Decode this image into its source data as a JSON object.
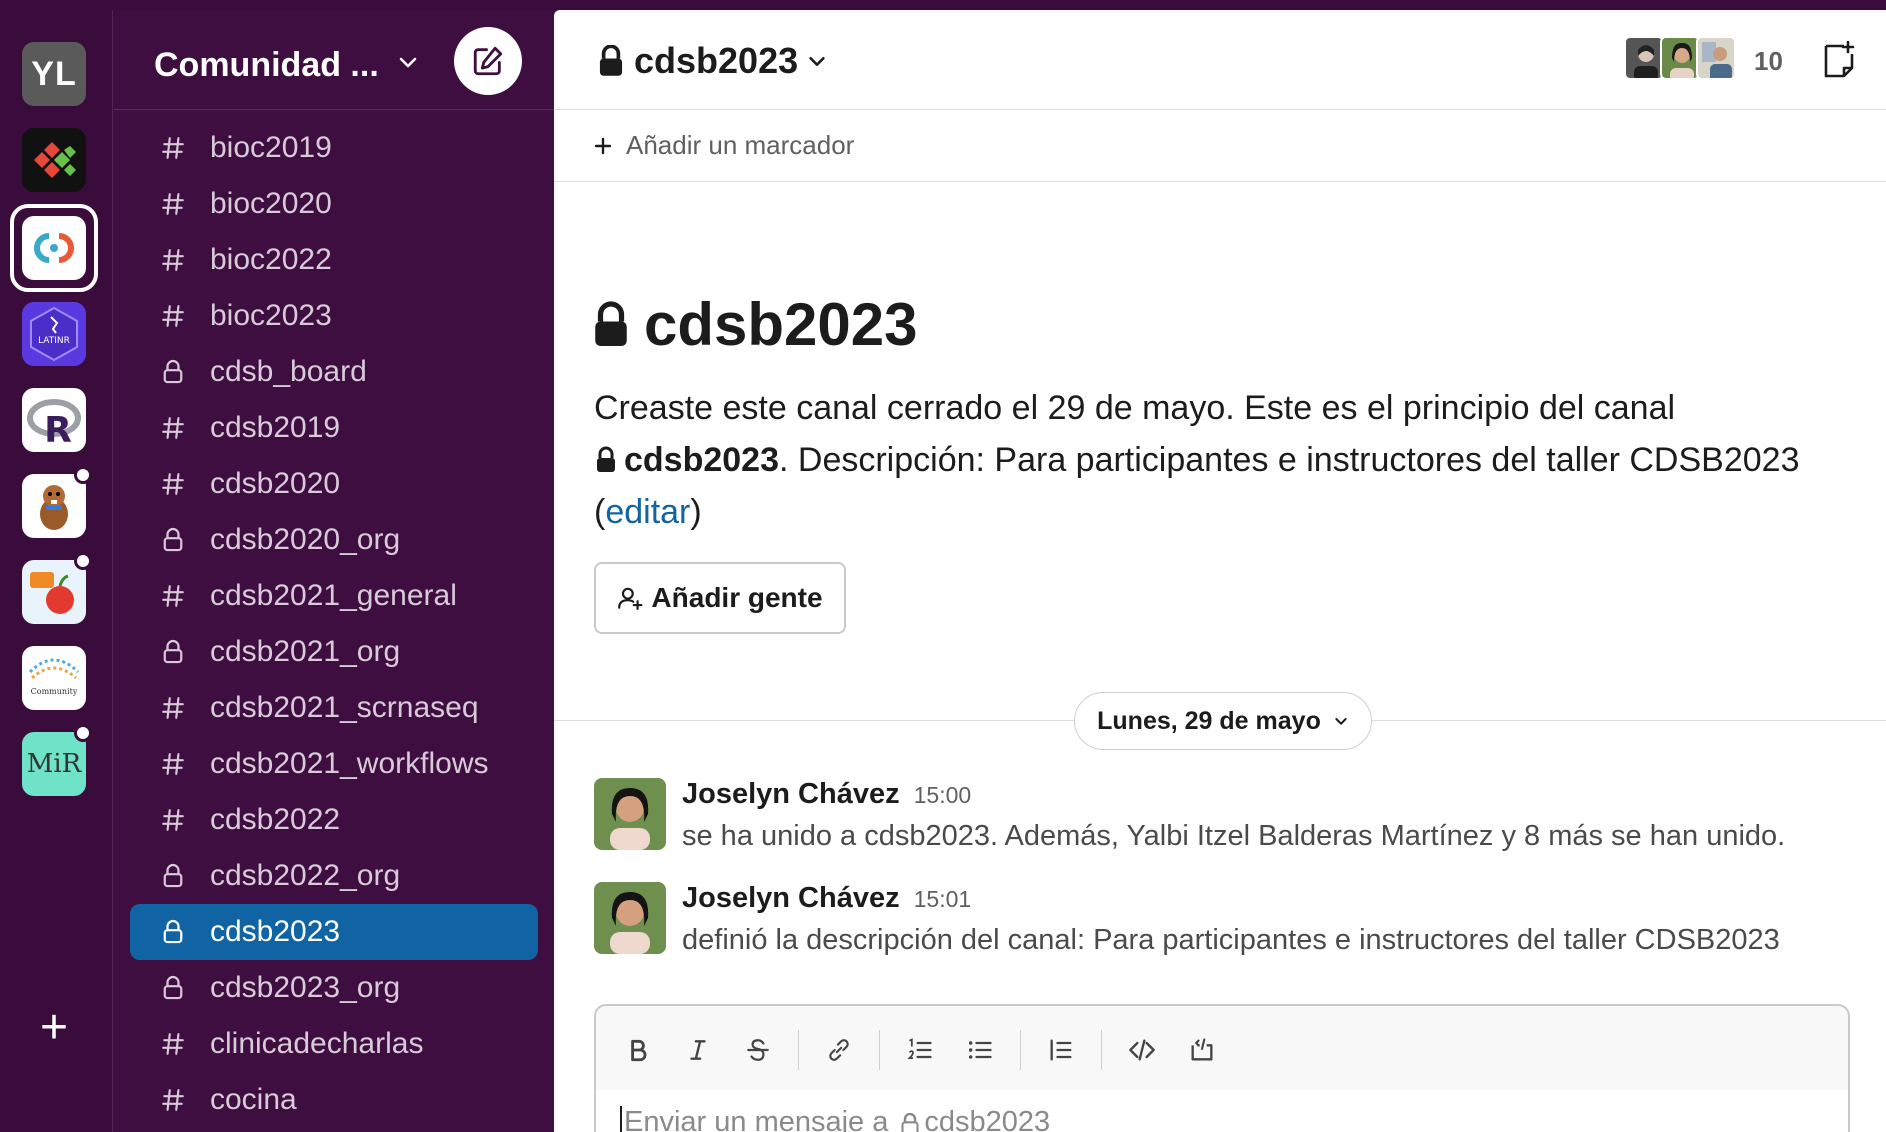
{
  "rail": {
    "workspaces": [
      {
        "initials": "YL",
        "name": "YL"
      },
      {
        "name": "Bioconductor"
      },
      {
        "name": "Comunidad de Desarrolladores de Software en Bioinformática"
      },
      {
        "name": "LatinR",
        "label": "LATINR"
      },
      {
        "name": "R workspace"
      },
      {
        "name": "rOpenSci"
      },
      {
        "name": "Apple community"
      },
      {
        "name": "Community",
        "label": "Community"
      },
      {
        "name": "MiR",
        "label": "MiR"
      }
    ],
    "add_label": "+"
  },
  "sidebar": {
    "workspace_name": "Comunidad ...",
    "channels": [
      {
        "name": "bioc2019",
        "type": "public"
      },
      {
        "name": "bioc2020",
        "type": "public"
      },
      {
        "name": "bioc2022",
        "type": "public"
      },
      {
        "name": "bioc2023",
        "type": "public"
      },
      {
        "name": "cdsb_board",
        "type": "private"
      },
      {
        "name": "cdsb2019",
        "type": "public"
      },
      {
        "name": "cdsb2020",
        "type": "public"
      },
      {
        "name": "cdsb2020_org",
        "type": "private"
      },
      {
        "name": "cdsb2021_general",
        "type": "public"
      },
      {
        "name": "cdsb2021_org",
        "type": "private"
      },
      {
        "name": "cdsb2021_scrnaseq",
        "type": "public"
      },
      {
        "name": "cdsb2021_workflows",
        "type": "public"
      },
      {
        "name": "cdsb2022",
        "type": "public"
      },
      {
        "name": "cdsb2022_org",
        "type": "private"
      },
      {
        "name": "cdsb2023",
        "type": "private",
        "active": true
      },
      {
        "name": "cdsb2023_org",
        "type": "private"
      },
      {
        "name": "clinicadecharlas",
        "type": "public"
      },
      {
        "name": "cocina",
        "type": "public"
      }
    ]
  },
  "header": {
    "channel_name": "cdsb2023",
    "member_count": "10"
  },
  "bookmarks": {
    "add_label": "Añadir un marcador"
  },
  "intro": {
    "title": "cdsb2023",
    "desc_part1": "Creaste este canal cerrado el 29 de mayo. Este es el principio del canal",
    "channel_name": "cdsb2023",
    "desc_part2": ". Descripción: Para participantes e instructores del taller CDSB2023",
    "edit_open": "(",
    "edit_link": "editar",
    "edit_close": ")",
    "add_people_label": "Añadir gente"
  },
  "date_divider": "Lunes, 29 de mayo",
  "messages": [
    {
      "author": "Joselyn Chávez",
      "time": "15:00",
      "text": "se ha unido a cdsb2023. Además, Yalbi Itzel Balderas Martínez y 8 más se han unido."
    },
    {
      "author": "Joselyn Chávez",
      "time": "15:01",
      "text": "definió la descripción del canal: Para participantes e instructores del taller CDSB2023"
    }
  ],
  "composer": {
    "placeholder_prefix": "Enviar un mensaje a",
    "placeholder_channel": "cdsb2023"
  },
  "colors": {
    "sidebar_bg": "#3f0e40",
    "active_channel": "#1164a3",
    "link": "#1264a3"
  }
}
